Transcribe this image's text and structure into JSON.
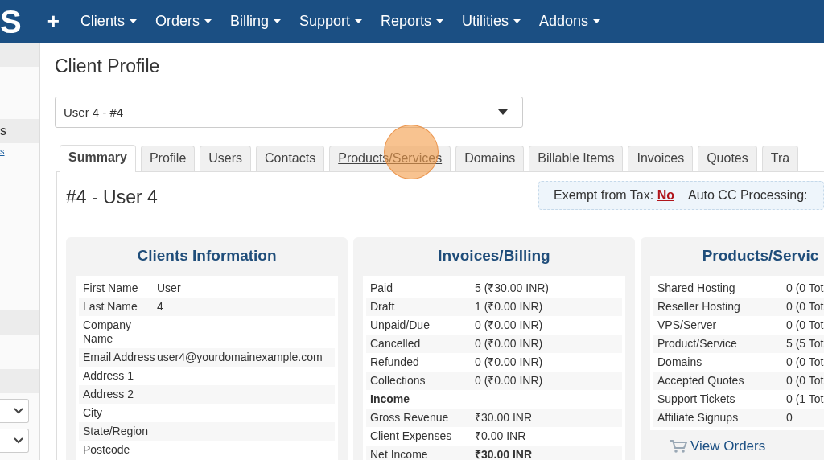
{
  "nav": {
    "logo": "S",
    "add": "+",
    "items": [
      {
        "label": "Clients"
      },
      {
        "label": "Orders"
      },
      {
        "label": "Billing"
      },
      {
        "label": "Support"
      },
      {
        "label": "Reports"
      },
      {
        "label": "Utilities"
      },
      {
        "label": "Addons"
      }
    ]
  },
  "sidebar": {
    "items": [
      {
        "label": "s",
        "kind": "active"
      },
      {
        "label": "s",
        "kind": "link"
      }
    ],
    "dropdowns": [
      {
        "kind": "select"
      },
      {
        "kind": "select"
      }
    ]
  },
  "page_title": "Client Profile",
  "client_select": {
    "value": "User 4 - #4"
  },
  "tabs": [
    {
      "label": "Summary",
      "selected": true,
      "hovered": false
    },
    {
      "label": "Profile",
      "selected": false,
      "hovered": false
    },
    {
      "label": "Users",
      "selected": false,
      "hovered": false
    },
    {
      "label": "Contacts",
      "selected": false,
      "hovered": false
    },
    {
      "label": "Products/Services",
      "selected": false,
      "hovered": true
    },
    {
      "label": "Domains",
      "selected": false,
      "hovered": false
    },
    {
      "label": "Billable Items",
      "selected": false,
      "hovered": false
    },
    {
      "label": "Invoices",
      "selected": false,
      "hovered": false
    },
    {
      "label": "Quotes",
      "selected": false,
      "hovered": false
    },
    {
      "label": "Tra",
      "selected": false,
      "hovered": false
    }
  ],
  "client_heading": "#4 - User 4",
  "tax_box": {
    "exempt_label": "Exempt from Tax:",
    "exempt_value": "No",
    "auto_cc_label": "Auto CC Processing:"
  },
  "cards": [
    {
      "title": "Clients Information",
      "rows": [
        {
          "label": "First Name",
          "value": "User",
          "kind": "normal"
        },
        {
          "label": "Last Name",
          "value": "4",
          "kind": "normal"
        },
        {
          "label": "Company Name",
          "kind": "normal"
        },
        {
          "label": "Email Address",
          "value": "user4@yourdomainexample.com",
          "kind": "normal"
        },
        {
          "label": "Address 1",
          "kind": "normal"
        },
        {
          "label": "Address 2",
          "kind": "normal"
        },
        {
          "label": "City",
          "kind": "normal"
        },
        {
          "label": "State/Region",
          "kind": "normal"
        },
        {
          "label": "Postcode",
          "kind": "normal"
        }
      ]
    },
    {
      "title": "Invoices/Billing",
      "rows": [
        {
          "label": "Paid",
          "value": "5 (₹30.00 INR)",
          "kind": "normal"
        },
        {
          "label": "Draft",
          "value": "1 (₹0.00 INR)",
          "kind": "normal"
        },
        {
          "label": "Unpaid/Due",
          "value": "0 (₹0.00 INR)",
          "kind": "normal"
        },
        {
          "label": "Cancelled",
          "value": "0 (₹0.00 INR)",
          "kind": "normal"
        },
        {
          "label": "Refunded",
          "value": "0 (₹0.00 INR)",
          "kind": "normal"
        },
        {
          "label": "Collections",
          "value": "0 (₹0.00 INR)",
          "kind": "normal"
        },
        {
          "label": "Income",
          "kind": "heading"
        },
        {
          "label": "Gross Revenue",
          "value": "₹30.00 INR",
          "kind": "normal"
        },
        {
          "label": "Client Expenses",
          "value": "₹0.00 INR",
          "kind": "normal"
        },
        {
          "label": "Net Income",
          "value": "₹30.00 INR",
          "kind": "total"
        }
      ]
    },
    {
      "title": "Products/Servic",
      "rows": [
        {
          "label": "Shared Hosting",
          "value": "0 (0 Tot",
          "kind": "normal"
        },
        {
          "label": "Reseller Hosting",
          "value": "0 (0 Tot",
          "kind": "normal"
        },
        {
          "label": "VPS/Server",
          "value": "0 (0 Tot",
          "kind": "normal"
        },
        {
          "label": "Product/Service",
          "value": "5 (5 Tot",
          "kind": "normal"
        },
        {
          "label": "Domains",
          "value": "0 (0 Tot",
          "kind": "normal"
        },
        {
          "label": "Accepted Quotes",
          "value": "0 (0 Tot",
          "kind": "normal"
        },
        {
          "label": "Support Tickets",
          "value": "0 (1 Tot",
          "kind": "normal"
        },
        {
          "label": "Affiliate Signups",
          "value": "0",
          "kind": "normal"
        }
      ],
      "link": "View Orders"
    }
  ]
}
